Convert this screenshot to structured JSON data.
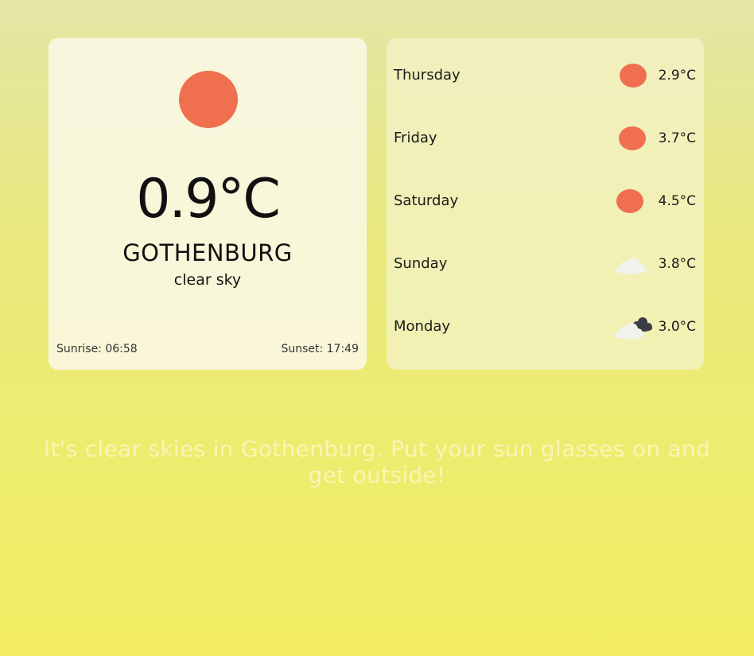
{
  "colors": {
    "sun": "#ef6f4f",
    "cloud_light": "#f2f2ec",
    "cloud_dark": "#3d3d46",
    "message_text": "#fbfae0"
  },
  "current": {
    "icon": "sun-icon",
    "temperature": "0.9°C",
    "city": "GOTHENBURG",
    "description": "clear sky",
    "sunrise": "Sunrise: 06:58",
    "sunset": "Sunset: 17:49"
  },
  "forecast": [
    {
      "day": "Thursday",
      "icon": "sun-icon",
      "temp": "2.9°C"
    },
    {
      "day": "Friday",
      "icon": "sun-icon",
      "temp": "3.7°C"
    },
    {
      "day": "Saturday",
      "icon": "sun-icon",
      "temp": "4.5°C"
    },
    {
      "day": "Sunday",
      "icon": "cloud-icon",
      "temp": "3.8°C"
    },
    {
      "day": "Monday",
      "icon": "broken-clouds-icon",
      "temp": "3.0°C"
    }
  ],
  "message": "It's clear skies in Gothenburg. Put your sun glasses on and get outside!"
}
